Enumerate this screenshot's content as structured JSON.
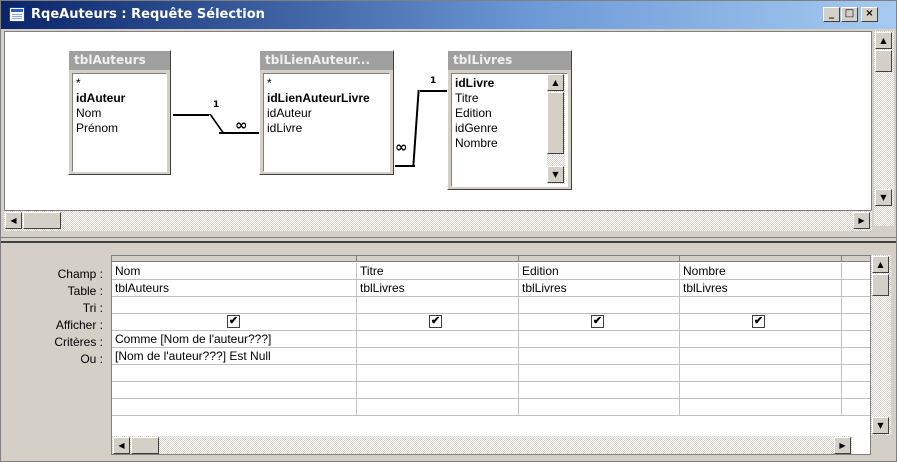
{
  "window": {
    "title": "RqeAuteurs : Requête Sélection",
    "min_glyph": "_",
    "max_glyph": "□",
    "close_glyph": "×"
  },
  "tables": [
    {
      "name": "tblAuteurs",
      "fields": [
        {
          "label": "*",
          "key": false
        },
        {
          "label": "idAuteur",
          "key": true
        },
        {
          "label": "Nom",
          "key": false
        },
        {
          "label": "Prénom",
          "key": false
        }
      ]
    },
    {
      "name": "tblLienAuteur...",
      "fields": [
        {
          "label": "*",
          "key": false
        },
        {
          "label": "idLienAuteurLivre",
          "key": true
        },
        {
          "label": "idAuteur",
          "key": false
        },
        {
          "label": "idLivre",
          "key": false
        }
      ]
    },
    {
      "name": "tblLivres",
      "fields": [
        {
          "label": "idLivre",
          "key": true
        },
        {
          "label": "Titre",
          "key": false
        },
        {
          "label": "Edition",
          "key": false
        },
        {
          "label": "idGenre",
          "key": false
        },
        {
          "label": "Nombre",
          "key": false
        }
      ]
    }
  ],
  "relations": {
    "one": "1",
    "many": "∞"
  },
  "grid": {
    "row_labels": [
      "Champ :",
      "Table :",
      "Tri :",
      "Afficher :",
      "Critères :",
      "Ou :"
    ],
    "columns": [
      {
        "champ": "Nom",
        "table": "tblAuteurs",
        "tri": "",
        "afficher": true,
        "criteres": "Comme [Nom de l'auteur???]",
        "ou": "[Nom de l'auteur???] Est Null"
      },
      {
        "champ": "Titre",
        "table": "tblLivres",
        "tri": "",
        "afficher": true,
        "criteres": "",
        "ou": ""
      },
      {
        "champ": "Edition",
        "table": "tblLivres",
        "tri": "",
        "afficher": true,
        "criteres": "",
        "ou": ""
      },
      {
        "champ": "Nombre",
        "table": "tblLivres",
        "tri": "",
        "afficher": true,
        "criteres": "",
        "ou": ""
      }
    ]
  },
  "icons": {
    "checkmark": "✔",
    "arrow_up": "▲",
    "arrow_down": "▼",
    "arrow_left": "◀",
    "arrow_right": "▶"
  }
}
